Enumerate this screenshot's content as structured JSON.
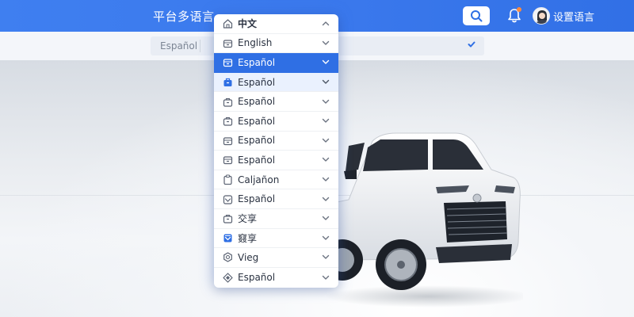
{
  "header": {
    "app_title": "平台多语言",
    "settings_label": "设置语言"
  },
  "toolbar": {
    "selected_language": "Español"
  },
  "dropdown": {
    "items": [
      {
        "label": "中文",
        "icon": "home-icon",
        "state": "header"
      },
      {
        "label": "English",
        "icon": "box-icon",
        "state": "normal"
      },
      {
        "label": "Español",
        "icon": "box-icon",
        "state": "selected"
      },
      {
        "label": "Español",
        "icon": "bag-filled-icon",
        "state": "hover"
      },
      {
        "label": "Español",
        "icon": "bag-icon",
        "state": "normal"
      },
      {
        "label": "Español",
        "icon": "bag-icon",
        "state": "normal"
      },
      {
        "label": "Español",
        "icon": "box-icon",
        "state": "normal"
      },
      {
        "label": "Español",
        "icon": "box-icon",
        "state": "normal"
      },
      {
        "label": "Caljañon",
        "icon": "clipboard-icon",
        "state": "normal"
      },
      {
        "label": "Español",
        "icon": "tray-icon",
        "state": "normal"
      },
      {
        "label": "交享",
        "icon": "bag-icon",
        "state": "normal"
      },
      {
        "label": "窡享",
        "icon": "inbox-filled-icon",
        "state": "normal"
      },
      {
        "label": "Vieg",
        "icon": "gear-icon",
        "state": "normal"
      },
      {
        "label": "Español",
        "icon": "diamond-icon",
        "state": "normal"
      }
    ]
  },
  "colors": {
    "header_blue": "#3a78ec",
    "selected_blue": "#2f6fe4",
    "hover_blue": "#eaf1fe",
    "notification_dot": "#ff8a3d"
  }
}
